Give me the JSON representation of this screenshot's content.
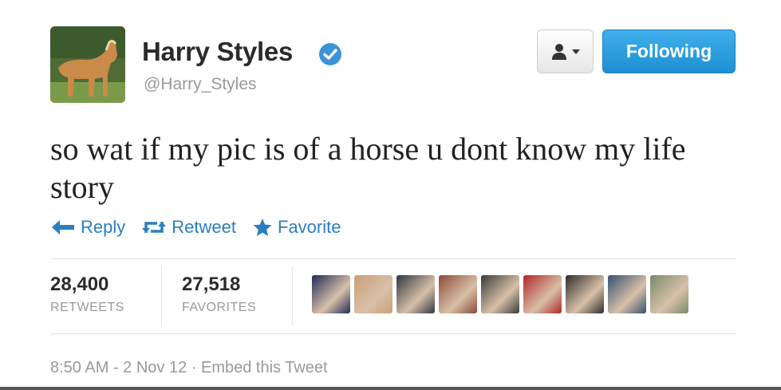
{
  "user": {
    "name": "Harry Styles",
    "handle": "@Harry_Styles",
    "verified": true
  },
  "buttons": {
    "follow_label": "Following",
    "user_menu_icon": "user-dropdown-icon"
  },
  "tweet": {
    "text": "so wat if my pic is of a horse u dont know my life story"
  },
  "actions": {
    "reply": "Reply",
    "retweet": "Retweet",
    "favorite": "Favorite"
  },
  "stats": {
    "retweets_count": "28,400",
    "retweets_label": "RETWEETS",
    "favorites_count": "27,518",
    "favorites_label": "FAVORITES"
  },
  "favoriters": [
    {
      "color": "#1f2a55"
    },
    {
      "color": "#c9a07a"
    },
    {
      "color": "#2e3540"
    },
    {
      "color": "#8a4a3a"
    },
    {
      "color": "#3a3a3a"
    },
    {
      "color": "#b02828"
    },
    {
      "color": "#2c2c2c"
    },
    {
      "color": "#355070"
    },
    {
      "color": "#7a8a6a"
    }
  ],
  "footer": {
    "time": "8:50 AM - 2 Nov 12",
    "separator": " · ",
    "embed": "Embed this Tweet"
  },
  "colors": {
    "link_blue": "#2a7fbf",
    "follow_blue": "#2ba1e0",
    "verified_blue": "#3b94d9"
  }
}
